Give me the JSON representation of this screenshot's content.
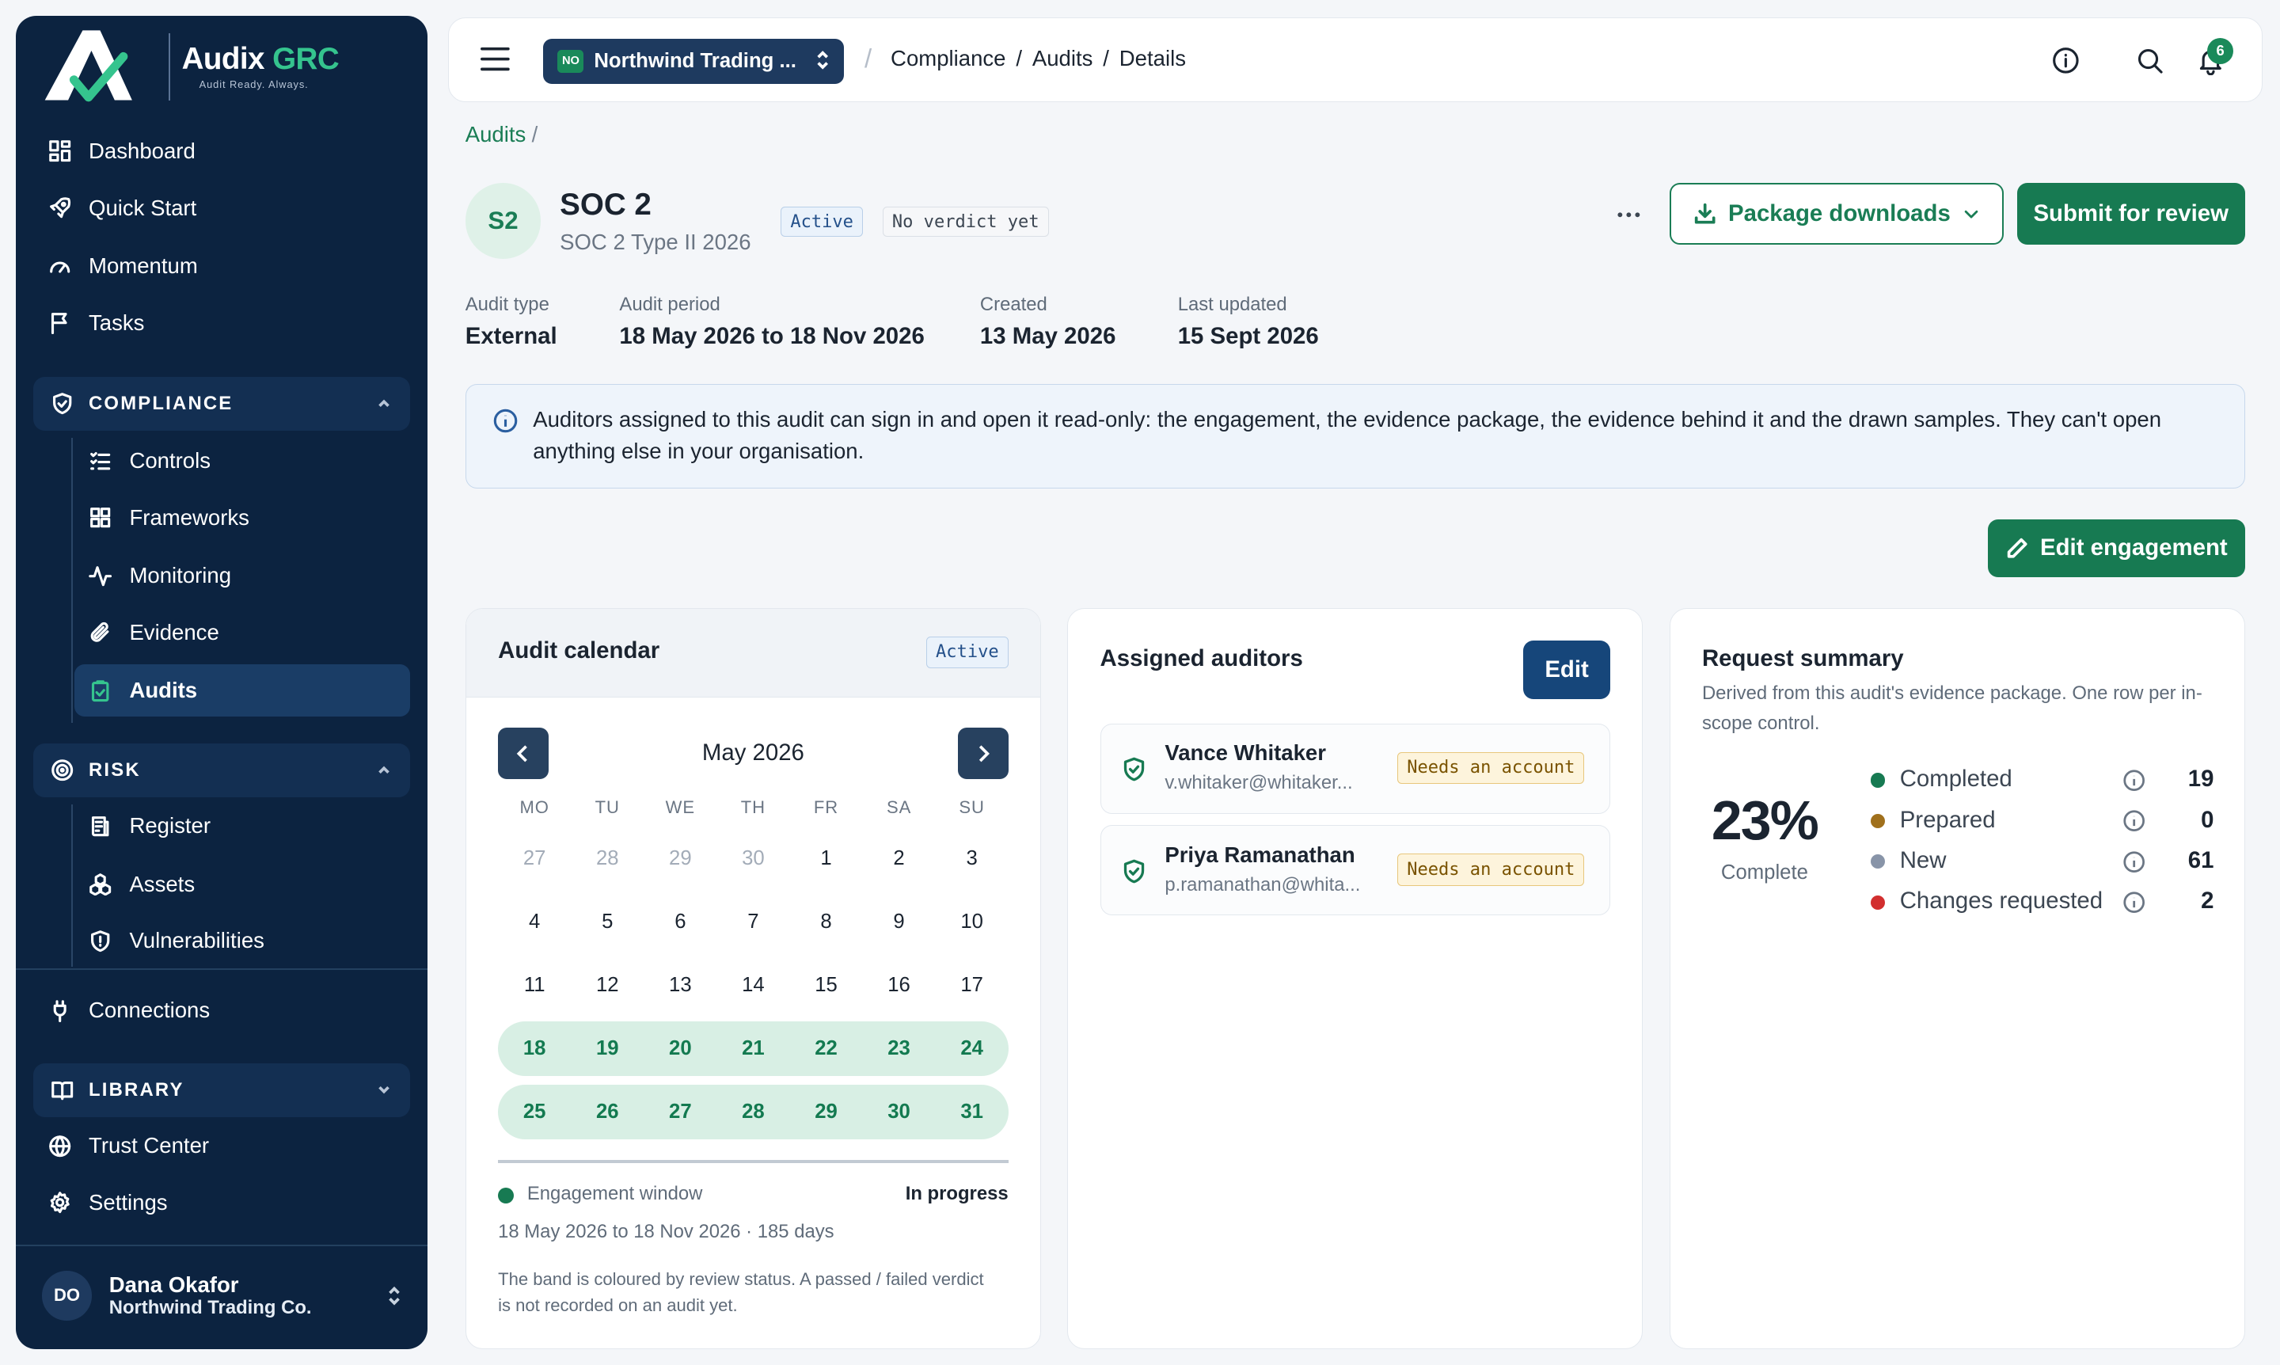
{
  "brand": {
    "name_main": "Audix",
    "name_accent": "GRC",
    "tagline": "Audit Ready. Always."
  },
  "sidebar": {
    "top_items": [
      {
        "label": "Dashboard",
        "icon": "dashboard-icon"
      },
      {
        "label": "Quick Start",
        "icon": "rocket-icon"
      },
      {
        "label": "Momentum",
        "icon": "gauge-icon"
      },
      {
        "label": "Tasks",
        "icon": "flag-icon"
      }
    ],
    "compliance": {
      "label": "COMPLIANCE",
      "items": [
        {
          "label": "Controls",
          "icon": "checklist-icon"
        },
        {
          "label": "Frameworks",
          "icon": "grid-icon"
        },
        {
          "label": "Monitoring",
          "icon": "activity-icon"
        },
        {
          "label": "Evidence",
          "icon": "paperclip-icon"
        },
        {
          "label": "Audits",
          "icon": "clipboard-check-icon",
          "active": true
        }
      ]
    },
    "risk": {
      "label": "RISK",
      "items": [
        {
          "label": "Register",
          "icon": "register-icon"
        },
        {
          "label": "Assets",
          "icon": "boxes-icon"
        },
        {
          "label": "Vulnerabilities",
          "icon": "shield-alert-icon"
        }
      ]
    },
    "connections": {
      "label": "Connections",
      "icon": "plug-icon"
    },
    "library": {
      "label": "LIBRARY"
    },
    "bottom_items": [
      {
        "label": "Trust Center",
        "icon": "globe-icon"
      },
      {
        "label": "Settings",
        "icon": "gear-icon"
      }
    ],
    "user": {
      "initials": "DO",
      "name": "Dana Okafor",
      "org": "Northwind Trading Co."
    }
  },
  "topbar": {
    "org_badge": "NO",
    "org_name": "Northwind Trading ...",
    "crumbs": [
      "Compliance",
      "/",
      "Audits",
      "/",
      "Details"
    ],
    "notification_count": "6"
  },
  "page": {
    "breadcrumb": "Audits",
    "breadcrumb_sep": "/",
    "avatar": "S2",
    "title": "SOC 2",
    "subtitle": "SOC 2 Type II 2026",
    "status_tag": "Active",
    "verdict_tag": "No verdict yet",
    "package_button": "Package downloads",
    "submit_button": "Submit for review",
    "meta": [
      {
        "label": "Audit type",
        "value": "External"
      },
      {
        "label": "Audit period",
        "value": "18 May 2026 to 18 Nov 2026"
      },
      {
        "label": "Created",
        "value": "13 May 2026"
      },
      {
        "label": "Last updated",
        "value": "15 Sept 2026"
      }
    ],
    "info_text": "Auditors assigned to this audit can sign in and open it read-only: the engagement, the evidence package, the evidence behind it and the drawn samples. They can't open anything else in your organisation.",
    "edit_engagement": "Edit engagement"
  },
  "calendar": {
    "title": "Audit calendar",
    "tag": "Active",
    "month": "May 2026",
    "dow": [
      "MO",
      "TU",
      "WE",
      "TH",
      "FR",
      "SA",
      "SU"
    ],
    "weeks": [
      [
        "27",
        "28",
        "29",
        "30",
        "1",
        "2",
        "3"
      ],
      [
        "4",
        "5",
        "6",
        "7",
        "8",
        "9",
        "10"
      ],
      [
        "11",
        "12",
        "13",
        "14",
        "15",
        "16",
        "17"
      ],
      [
        "18",
        "19",
        "20",
        "21",
        "22",
        "23",
        "24"
      ],
      [
        "25",
        "26",
        "27",
        "28",
        "29",
        "30",
        "31"
      ]
    ],
    "legend_label": "Engagement window",
    "legend_status": "In progress",
    "range_text": "18 May 2026 to 18 Nov 2026 · 185 days",
    "footnote": "The band is coloured by review status. A passed / failed verdict is not recorded on an audit yet."
  },
  "auditors": {
    "title": "Assigned auditors",
    "edit_label": "Edit",
    "list": [
      {
        "name": "Vance Whitaker",
        "email": "v.whitaker@whitaker...",
        "badge": "Needs an account"
      },
      {
        "name": "Priya Ramanathan",
        "email": "p.ramanathan@whita...",
        "badge": "Needs an account"
      }
    ]
  },
  "request_summary": {
    "title": "Request summary",
    "desc": "Derived from this audit's evidence package. One row per in-scope control.",
    "percent": "23%",
    "percent_label": "Complete",
    "rows": [
      {
        "label": "Completed",
        "value": "19",
        "color": "#177a52"
      },
      {
        "label": "Prepared",
        "value": "0",
        "color": "#a0701c"
      },
      {
        "label": "New",
        "value": "61",
        "color": "#8894a8"
      },
      {
        "label": "Changes requested",
        "value": "2",
        "color": "#d22f2f"
      }
    ]
  }
}
